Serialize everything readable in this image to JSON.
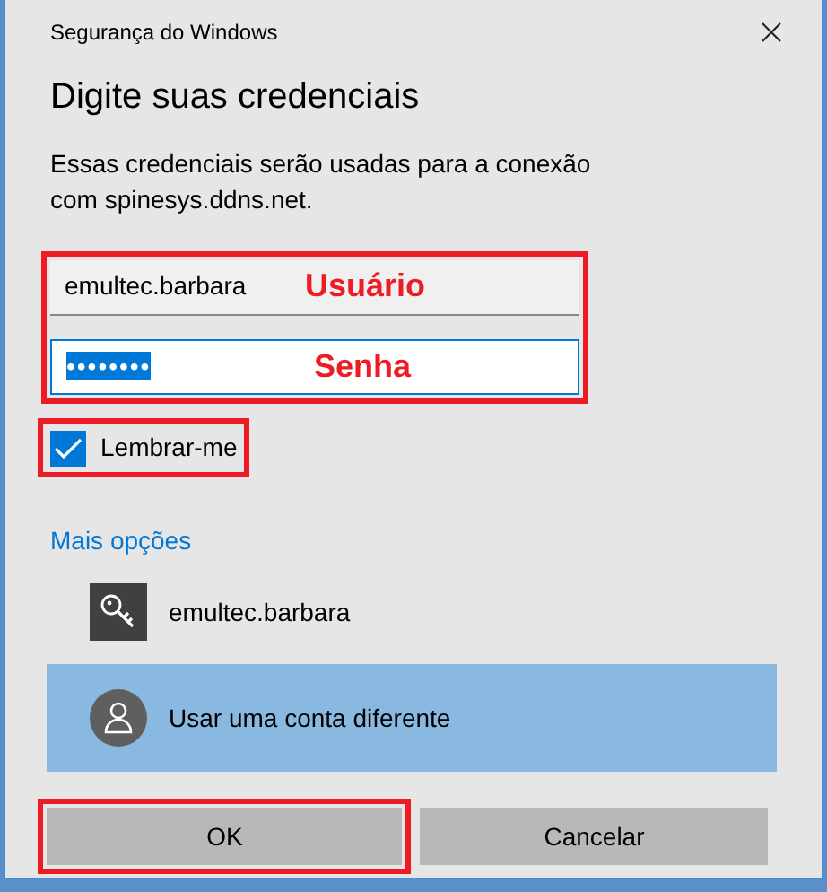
{
  "window": {
    "title": "Segurança do Windows"
  },
  "heading": "Digite suas credenciais",
  "description": "Essas credenciais serão usadas para a conexão com spinesys.ddns.net.",
  "fields_annotated": true,
  "fields": [
    {
      "kind": "text",
      "value": "emultec.barbara",
      "focused": false,
      "annotation": "Usuário"
    },
    {
      "kind": "password",
      "value": "••••••••",
      "focused": true,
      "annotation": "Senha"
    }
  ],
  "remember": {
    "label": "Lembrar-me",
    "checked": true,
    "annotated": true
  },
  "more_options": "Mais opções",
  "accounts": [
    {
      "kind": "key",
      "label": "emultec.barbara",
      "selected": false
    },
    {
      "kind": "person",
      "label": "Usar uma conta diferente",
      "selected": true
    }
  ],
  "buttons": [
    {
      "label": "OK",
      "annotated": true
    },
    {
      "label": "Cancelar",
      "annotated": false
    }
  ]
}
